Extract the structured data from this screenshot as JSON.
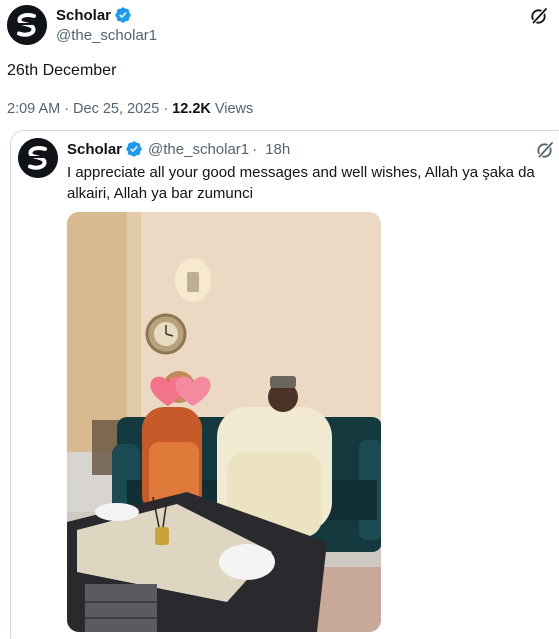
{
  "post": {
    "author_name": "Scholar",
    "author_handle": "@the_scholar1",
    "text": "26th December",
    "time": "2:09 AM",
    "date": "Dec 25, 2025",
    "views_count": "12.2K",
    "views_label": "Views"
  },
  "quoted": {
    "author_name": "Scholar",
    "author_handle": "@the_scholar1",
    "separator": "·",
    "age": "18h",
    "text": "I appreciate all your good messages and well wishes, Allah ya şaka da alkairi, Allah ya bar zumunci"
  },
  "meta_separator": "·",
  "icons": {
    "verified": "verified-badge-icon",
    "grok": "grok-icon"
  },
  "colors": {
    "verified": "#1d9bf0",
    "text_primary": "#0f1419",
    "text_secondary": "#536471",
    "border": "#cfd9de"
  }
}
